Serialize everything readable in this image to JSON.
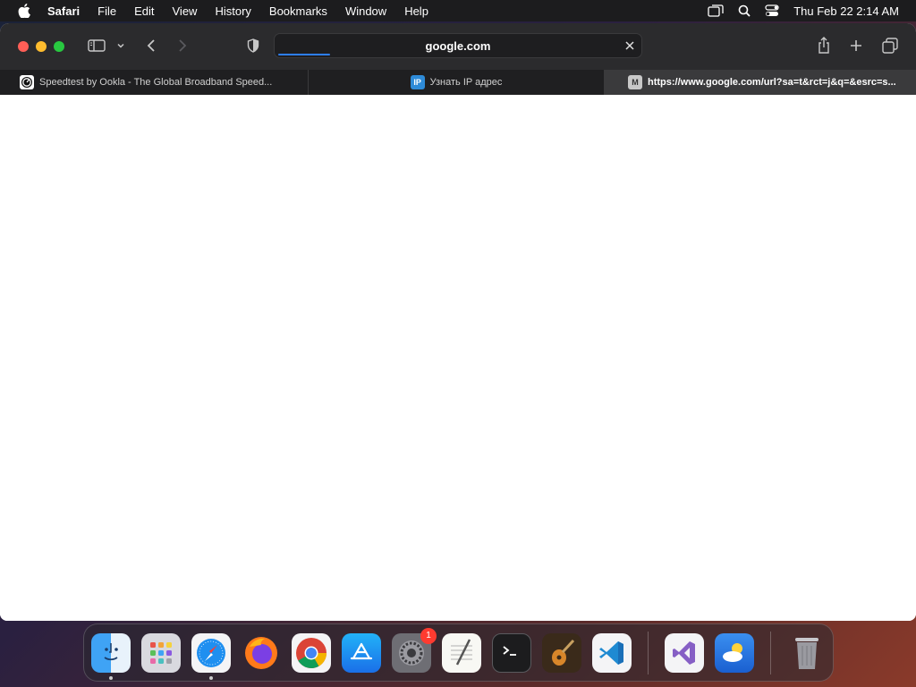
{
  "menubar": {
    "app_name": "Safari",
    "items": [
      "File",
      "Edit",
      "View",
      "History",
      "Bookmarks",
      "Window",
      "Help"
    ],
    "clock": "Thu Feb 22  2:14 AM"
  },
  "toolbar": {
    "address": "google.com",
    "loading_progress": 0.14
  },
  "tabs": [
    {
      "label": "Speedtest by Ookla - The Global Broadband Speed...",
      "favicon": "speedtest-icon",
      "active": false
    },
    {
      "label": "Узнать IP адрес",
      "favicon": "IP",
      "active": false
    },
    {
      "label": "https://www.google.com/url?sa=t&rct=j&q=&esrc=s...",
      "favicon": "M",
      "active": true
    }
  ],
  "dock": {
    "items": [
      "finder",
      "launchpad",
      "safari",
      "firefox",
      "chrome",
      "app-store",
      "system-settings",
      "textedit",
      "terminal",
      "garageband",
      "vscode",
      "visual-studio",
      "weather",
      "trash"
    ],
    "system_settings_badge": "1"
  },
  "colors": {
    "accent": "#2d7ff9",
    "close": "#ff5f57",
    "minimize": "#febc2e",
    "zoom": "#28c840"
  }
}
